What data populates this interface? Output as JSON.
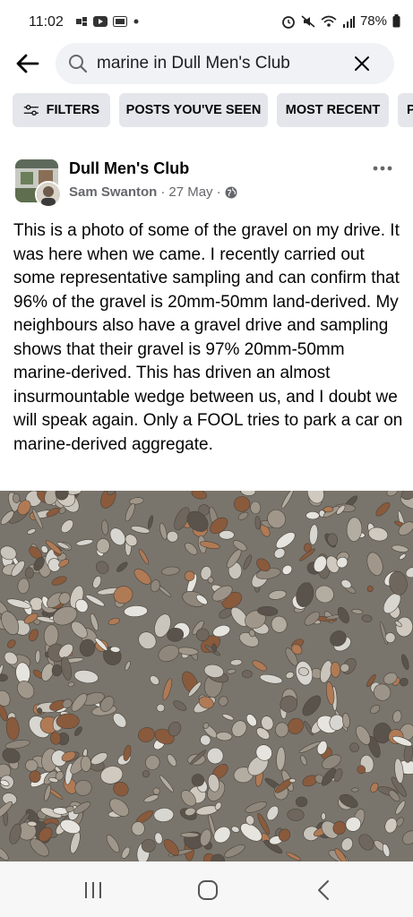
{
  "status_bar": {
    "time": "11:02",
    "battery": "78%"
  },
  "search": {
    "query": "marine in Dull Men's Club"
  },
  "filters": [
    {
      "label": "FILTERS",
      "icon": "sliders-icon"
    },
    {
      "label": "POSTS YOU'VE SEEN"
    },
    {
      "label": "MOST RECENT"
    },
    {
      "label": "P"
    }
  ],
  "post": {
    "group_name": "Dull Men's Club",
    "author": "Sam Swanton",
    "date": "27 May",
    "separator": "·",
    "privacy_icon": "globe-icon",
    "text": "This is a photo of some of the gravel on my drive. It was here when we came. I recently carried out some representative sampling and can confirm that 96% of the gravel is 20mm-50mm land-derived. My neighbours also have a gravel drive and sampling shows that their gravel is 97% 20mm-50mm marine-derived. This has driven an almost insurmountable wedge between us, and I doubt we will speak again. Only a FOOL tries to park a car on marine-derived aggregate."
  },
  "colors": {
    "chip_bg": "#e4e6eb",
    "search_bg": "#f0f2f5",
    "meta_text": "#65676b"
  }
}
